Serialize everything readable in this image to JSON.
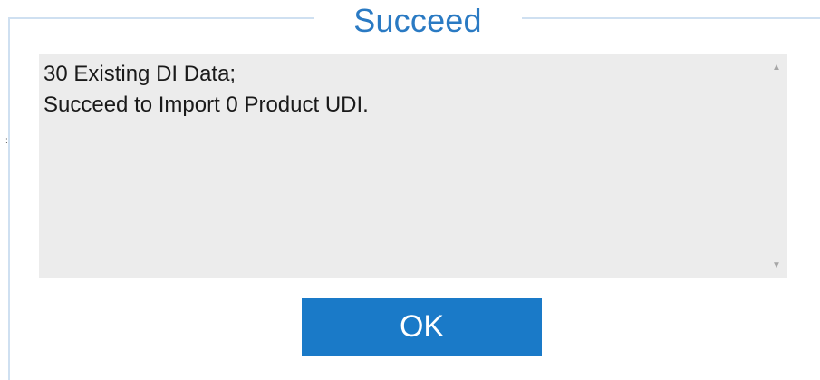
{
  "dialog": {
    "title": "Succeed",
    "message_lines": [
      "30 Existing DI Data;",
      "Succeed to Import 0 Product UDI."
    ],
    "ok_label": "OK"
  },
  "colors": {
    "title_blue": "#2a7ac3",
    "button_blue": "#1a7ac8",
    "message_background": "#ececec",
    "frame_border": "#cfe0f1"
  },
  "icons": {
    "scroll_up": "triangle-up",
    "scroll_down": "triangle-down"
  }
}
